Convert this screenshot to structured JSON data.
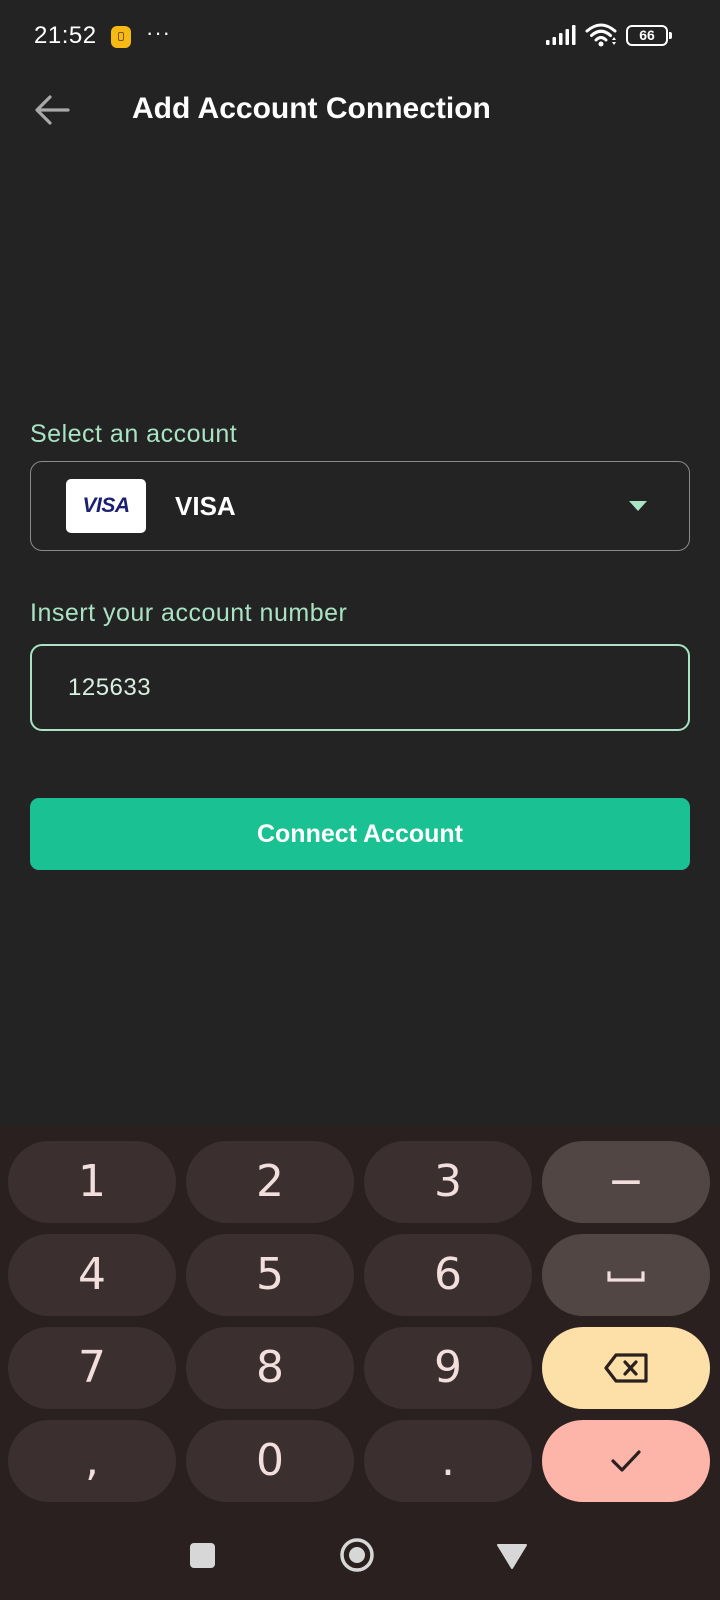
{
  "status_bar": {
    "time": "21:52",
    "more": "···",
    "battery": "66"
  },
  "header": {
    "title": "Add Account Connection"
  },
  "form": {
    "select_label": "Select an account",
    "selected_account": "VISA",
    "selected_logo_text": "VISA",
    "number_label": "Insert your account number",
    "account_number": "125633",
    "connect_label": "Connect Account"
  },
  "keyboard": {
    "keys": [
      "1",
      "2",
      "3",
      "4",
      "5",
      "6",
      "7",
      "8",
      "9",
      ",",
      "0",
      "."
    ],
    "minus_key": "−"
  },
  "colors": {
    "background": "#232323",
    "accent": "#19c193",
    "label": "#a9e3c3",
    "keyboard_background": "#2b2020",
    "backspace_key": "#fddfa8",
    "enter_key": "#fdb4a9"
  }
}
